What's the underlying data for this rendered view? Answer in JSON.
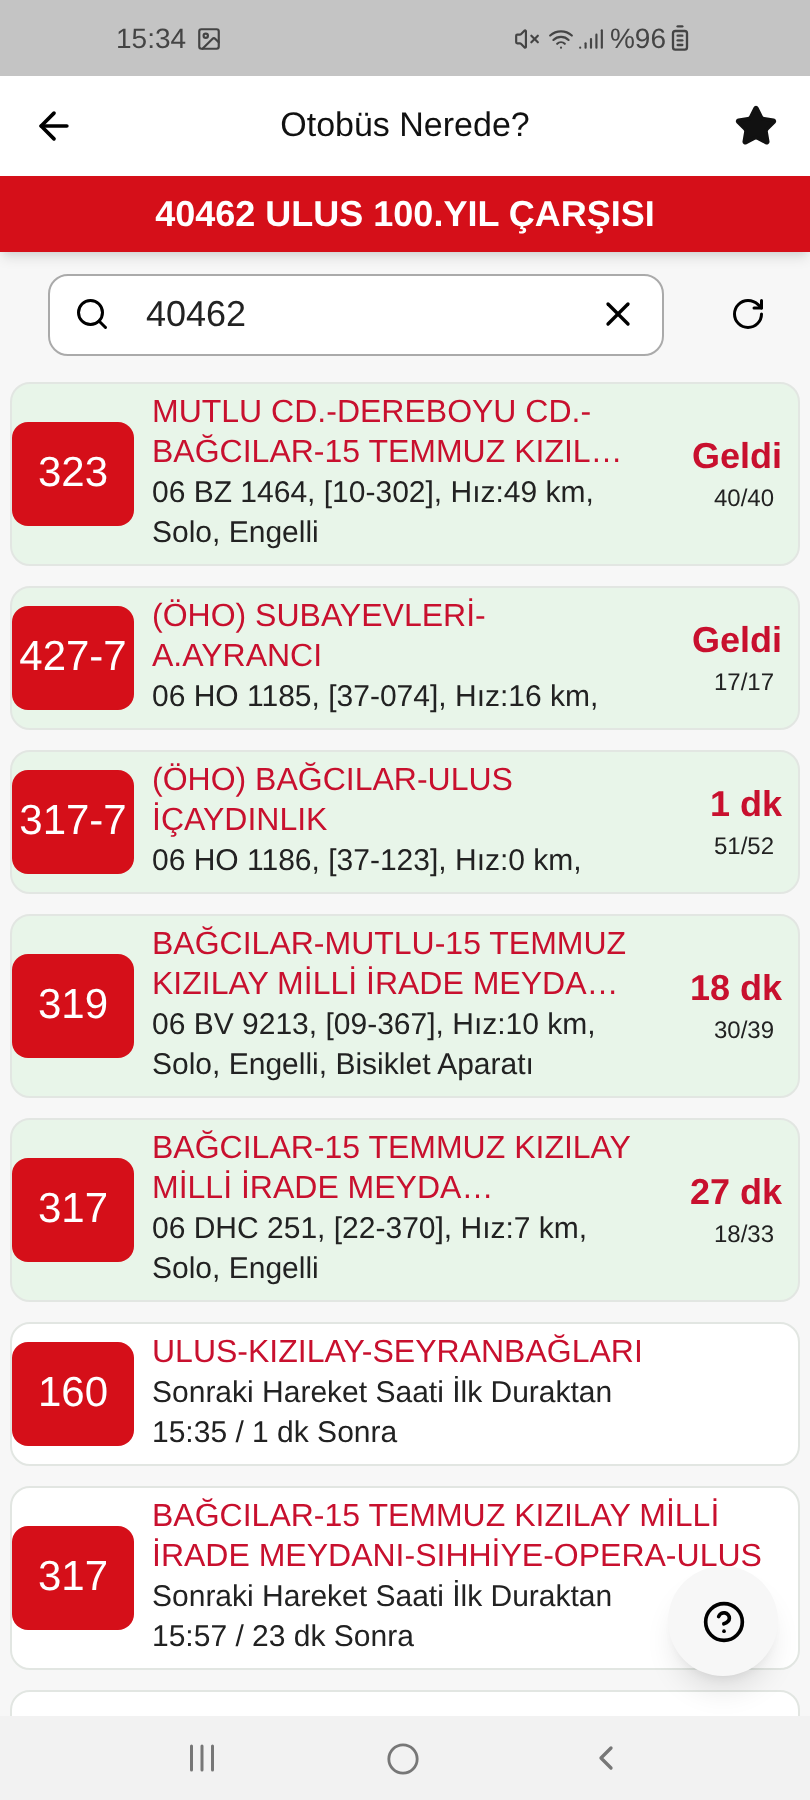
{
  "status_bar": {
    "time": "15:34",
    "battery": "%96"
  },
  "header": {
    "title": "Otobüs Nerede?",
    "favorite": true
  },
  "stop_banner": "40462 ULUS 100.YIL ÇARŞISI",
  "search": {
    "value": "40462"
  },
  "arrivals": [
    {
      "kind": "live",
      "line": "323",
      "route": "MUTLU CD.-DEREBOYU CD.-BAĞCILAR-15 TEMMUZ KIZIL…",
      "info": "06 BZ 1464, [10-302], Hız:49 km, Solo, Engelli",
      "eta": "Geldi",
      "stops": "40/40"
    },
    {
      "kind": "live",
      "line": "427-7",
      "route": "(ÖHO) SUBAYEVLERİ-A.AYRANCI",
      "info": "06 HO 1185, [37-074], Hız:16 km,",
      "eta": "Geldi",
      "stops": "17/17"
    },
    {
      "kind": "live",
      "line": "317-7",
      "route": "(ÖHO) BAĞCILAR-ULUS İÇAYDINLIK",
      "info": "06 HO 1186, [37-123], Hız:0 km,",
      "eta": "1 dk",
      "stops": "51/52"
    },
    {
      "kind": "live",
      "line": "319",
      "route": "BAĞCILAR-MUTLU-15 TEMMUZ KIZILAY MİLLİ İRADE MEYDA…",
      "info": "06 BV 9213, [09-367], Hız:10 km, Solo, Engelli, Bisiklet Aparatı",
      "eta": "18 dk",
      "stops": "30/39"
    },
    {
      "kind": "live",
      "line": "317",
      "route": "BAĞCILAR-15 TEMMUZ KIZILAY MİLLİ İRADE MEYDA…",
      "info": "06 DHC 251, [22-370], Hız:7 km, Solo, Engelli",
      "eta": "27 dk",
      "stops": "18/33"
    },
    {
      "kind": "scheduled",
      "line": "160",
      "route": "ULUS-KIZILAY-SEYRANBAĞLARI",
      "info": "Sonraki Hareket Saati İlk Duraktan",
      "time": "15:35 / 1 dk Sonra"
    },
    {
      "kind": "scheduled",
      "line": "317",
      "route": "BAĞCILAR-15 TEMMUZ KIZILAY MİLLİ İRADE MEYDANI-SIHHİYE-OPERA-ULUS",
      "info": "Sonraki Hareket Saati İlk Duraktan",
      "time": "15:57 / 23 dk Sonra"
    }
  ]
}
